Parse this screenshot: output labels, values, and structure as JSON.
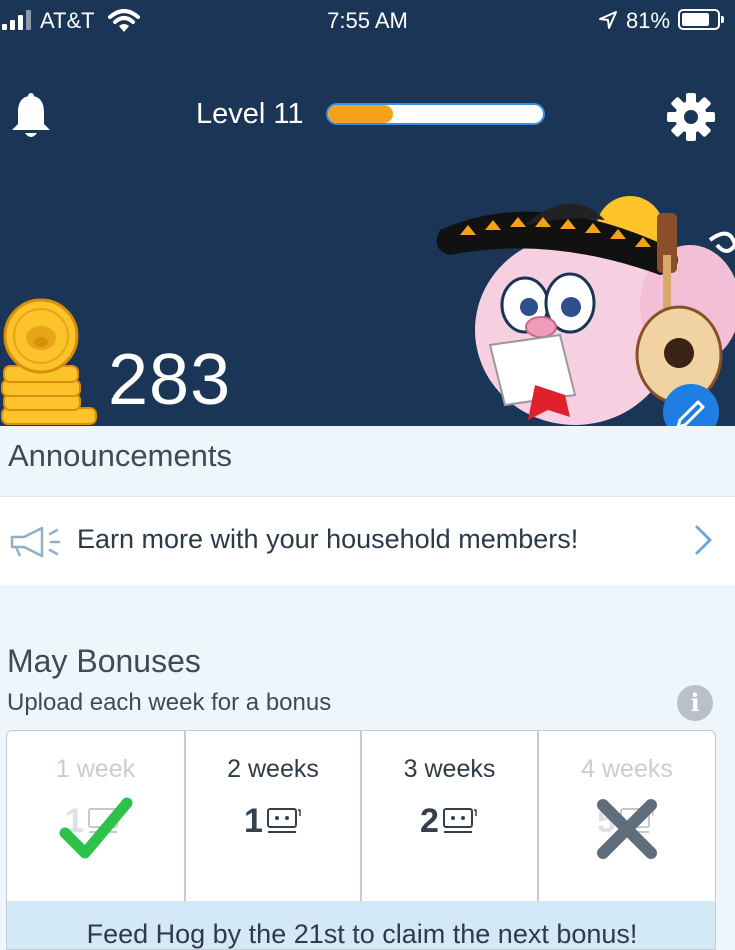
{
  "status_bar": {
    "carrier": "AT&T",
    "time": "7:55 AM",
    "battery_percent": "81%",
    "battery_level": 0.81
  },
  "header": {
    "level_label": "Level 11",
    "level_progress": 0.3,
    "points": "283",
    "icons": {
      "left": "bell-icon",
      "right": "gear-icon",
      "points": "coin-stack-icon",
      "mascot": "pig-mascot-with-sombrero-and-guitar",
      "edit": "pencil-icon"
    }
  },
  "announcements": {
    "heading": "Announcements",
    "item_text": "Earn more with your household members!",
    "item_icon": "megaphone-icon"
  },
  "bonuses": {
    "title": "May Bonuses",
    "subtitle": "Upload each week for a bonus",
    "cells": [
      {
        "label": "1 week",
        "value": "1",
        "state": "completed",
        "icon": "check-icon"
      },
      {
        "label": "2 weeks",
        "value": "1",
        "state": "upcoming",
        "icon": "ticket-icon"
      },
      {
        "label": "3 weeks",
        "value": "2",
        "state": "upcoming",
        "icon": "ticket-icon"
      },
      {
        "label": "4 weeks",
        "value": "5",
        "state": "missed",
        "icon": "x-icon"
      }
    ],
    "footer": "Feed Hog by the 21st to claim the next bonus!"
  },
  "colors": {
    "header_bg": "#1b3556",
    "progress_fill": "#f5a11c",
    "progress_border": "#3b8ee0",
    "check": "#2ec24a",
    "x_mark": "#5f6e7a",
    "footer_bg": "#d3e9f7"
  }
}
